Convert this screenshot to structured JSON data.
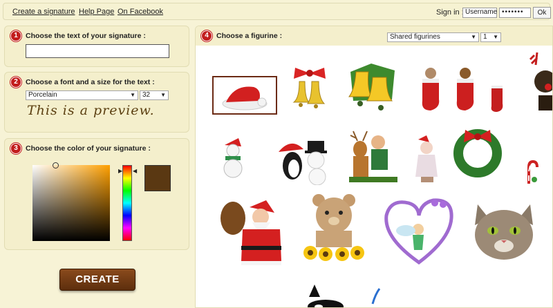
{
  "nav": {
    "create_label": "Create a signature",
    "help_label": "Help Page",
    "facebook_label": "On Facebook"
  },
  "signin": {
    "label": "Sign in :",
    "username_value": "Username",
    "password_value": "•••••••",
    "ok_label": "Ok"
  },
  "step1": {
    "number": "1",
    "title": "Choose the text of your signature :",
    "value": ""
  },
  "step2": {
    "number": "2",
    "title": "Choose a font and a size for the text :",
    "font": "Porcelain",
    "size": "32",
    "preview": "This is a preview."
  },
  "step3": {
    "number": "3",
    "title": "Choose the color of your signature :",
    "selected_color": "#5a3812"
  },
  "step4": {
    "number": "4",
    "title": "Choose a figurine :",
    "category": "Shared figurines",
    "page": "1"
  },
  "create_button": "CREATE",
  "figurines": [
    "santa-hat",
    "christmas-bells-bow",
    "golden-bells",
    "kitten-in-stocking",
    "puppy-in-stocking",
    "red-stocking",
    "reindeer-dog",
    "snowman",
    "penguin-and-snowman",
    "reindeer-and-kid",
    "christmas-angel",
    "christmas-wreath",
    "candy-cane",
    "santa-claus",
    "teddy-bear-sunflowers",
    "fairy-in-heart",
    "tabby-cat",
    "orca",
    "blue-feather"
  ]
}
